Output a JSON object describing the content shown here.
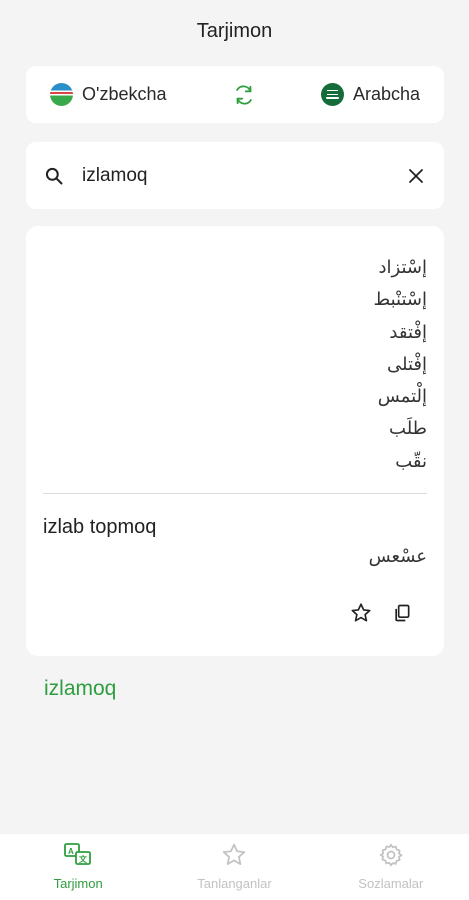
{
  "app": {
    "title": "Tarjimon"
  },
  "languages": {
    "source": {
      "label": "O'zbekcha",
      "flag": "uzbekistan-flag"
    },
    "target": {
      "label": "Arabcha",
      "flag": "saudi-arabia-flag"
    },
    "swap_icon": "swap-icon"
  },
  "search": {
    "value": "izlamoq",
    "placeholder": "",
    "search_icon": "search-icon",
    "clear_icon": "close-icon"
  },
  "result": {
    "arabic_words": [
      "إسْتزاد",
      "إسْتنْبط",
      "إفْتقد",
      "إفْتلى",
      "إلْتمس",
      "طلَب",
      "نقّب"
    ],
    "phrase": "izlab topmoq",
    "phrase_translation": "عسْعس",
    "actions": [
      "star-icon",
      "copy-icon"
    ]
  },
  "suggestion": "izlamoq",
  "nav": {
    "items": [
      {
        "label": "Tarjimon",
        "icon": "translate-icon",
        "active": true
      },
      {
        "label": "Tanlanganlar",
        "icon": "star-icon",
        "active": false
      },
      {
        "label": "Sozlamalar",
        "icon": "gear-icon",
        "active": false
      }
    ]
  },
  "colors": {
    "accent": "#2e9e3f",
    "background": "#f4f4f4",
    "card": "#ffffff",
    "inactive": "#c2c2c2"
  }
}
